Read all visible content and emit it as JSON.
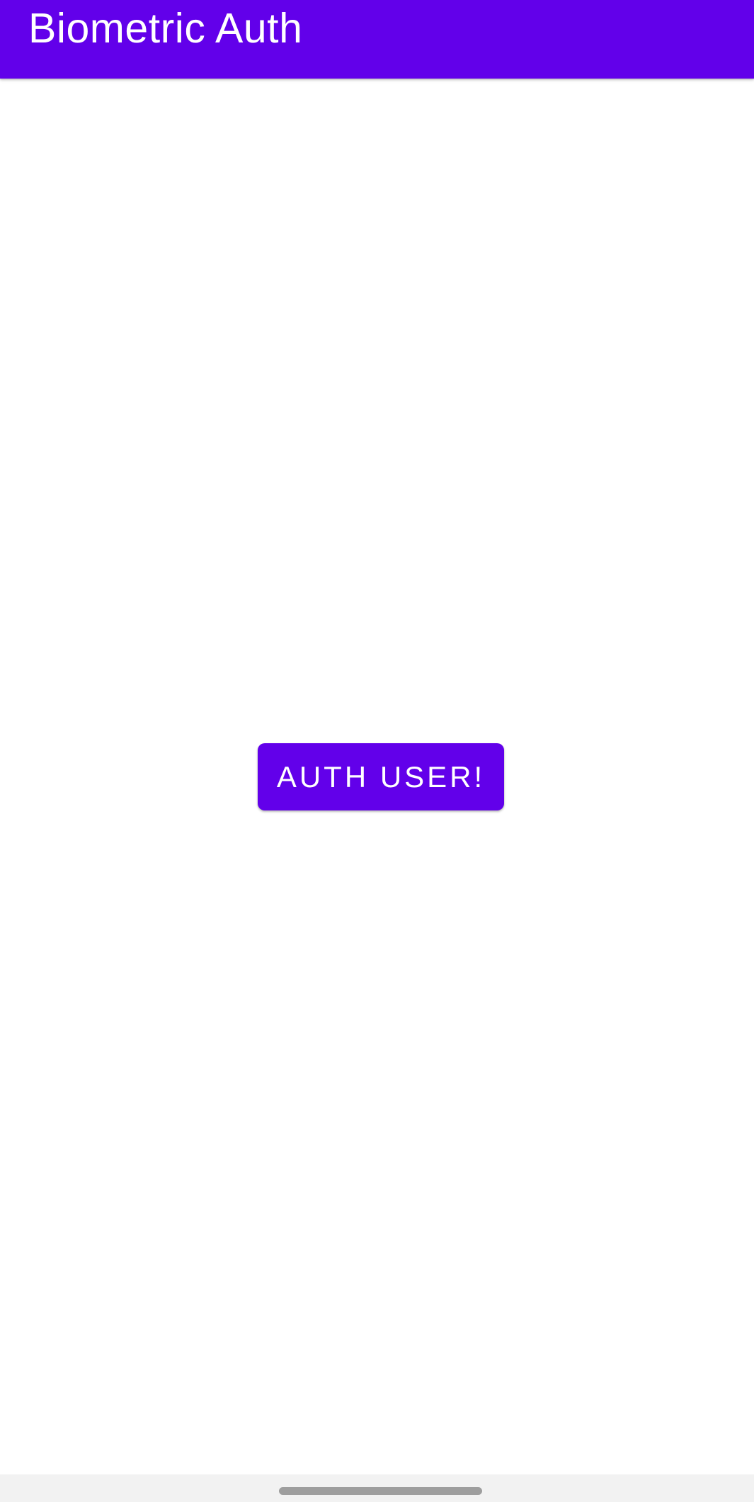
{
  "app_bar": {
    "title": "Biometric Auth"
  },
  "main": {
    "auth_button_label": "AUTH USER!"
  },
  "colors": {
    "primary": "#6200ea",
    "on_primary": "#ffffff",
    "background": "#ffffff",
    "nav_bar": "#f2f2f2",
    "nav_handle": "#9e9e9e"
  }
}
